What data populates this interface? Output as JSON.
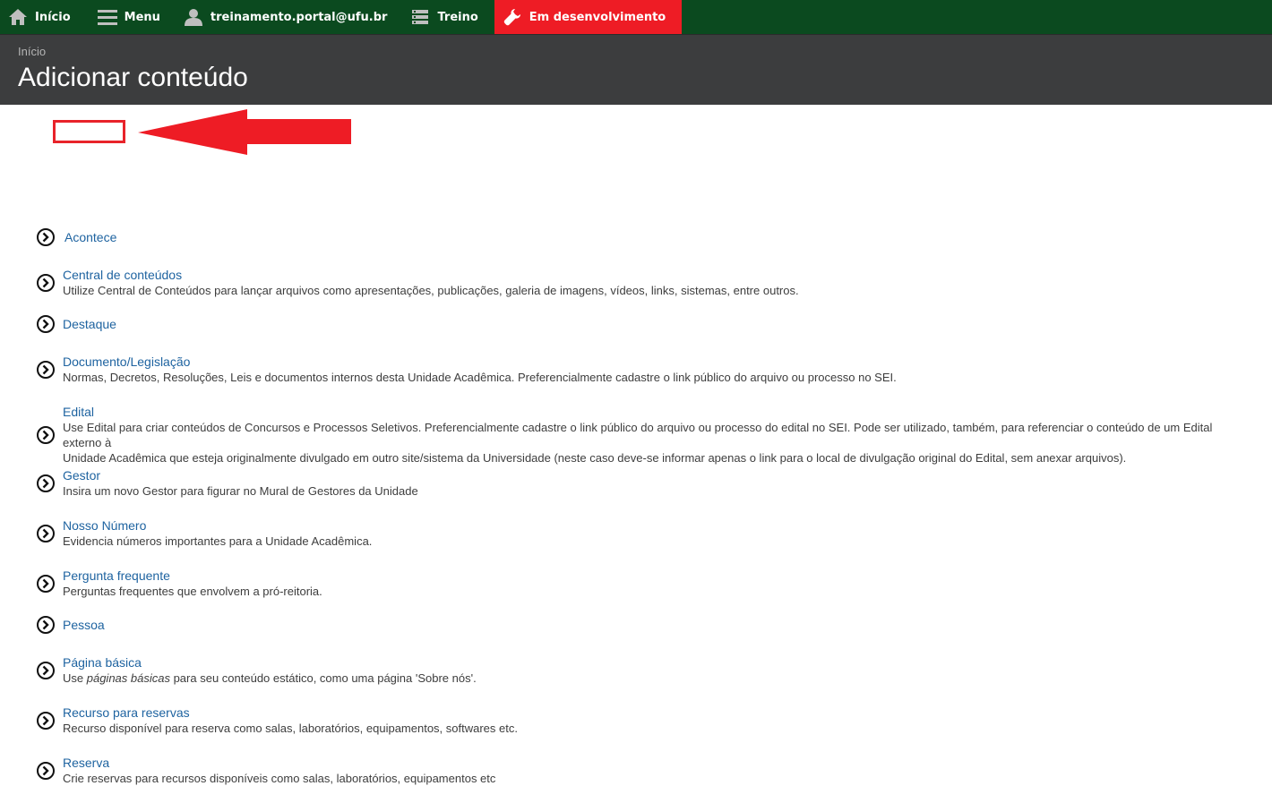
{
  "toolbar": {
    "home_label": "Início",
    "menu_label": "Menu",
    "user_label": "treinamento.portal@ufu.br",
    "shortcuts_label": "Treino",
    "dev_label": "Em desenvolvimento",
    "bg_color": "#0b4a1f",
    "dev_color": "#ee1c25"
  },
  "header": {
    "breadcrumb": "Início",
    "title": "Adicionar conteúdo"
  },
  "content_types": [
    {
      "label": "Acontece",
      "description": ""
    },
    {
      "label": "Central de conteúdos",
      "description": "Utilize Central de Conteúdos para lançar arquivos como apresentações, publicações, galeria de imagens, vídeos, links, sistemas, entre outros."
    },
    {
      "label": "Destaque",
      "description": ""
    },
    {
      "label": "Documento/Legislação",
      "description": "Normas, Decretos, Resoluções, Leis e documentos internos desta Unidade Acadêmica. Preferencialmente cadastre o link público do arquivo ou processo no SEI."
    },
    {
      "label": "Edital",
      "description_line1": "Use Edital para criar conteúdos de Concursos e Processos Seletivos. Preferencialmente cadastre o link público do arquivo ou processo do edital no SEI. Pode ser utilizado, também, para referenciar o conteúdo de um Edital externo à",
      "description_line2": "Unidade Acadêmica que esteja originalmente divulgado em outro site/sistema da Universidade (neste caso deve-se informar apenas o link para o local de divulgação original do Edital, sem anexar arquivos)."
    },
    {
      "label": "Gestor",
      "description": "Insira um novo Gestor para figurar no Mural de Gestores da Unidade"
    },
    {
      "label": "Nosso Número",
      "description": "Evidencia números importantes para a Unidade Acadêmica."
    },
    {
      "label": "Pergunta frequente",
      "description": "Perguntas frequentes que envolvem a pró-reitoria."
    },
    {
      "label": "Pessoa",
      "description": ""
    },
    {
      "label": "Página básica",
      "description_pre": "Use ",
      "description_em": "páginas básicas",
      "description_post": " para seu conteúdo estático, como uma página 'Sobre nós'."
    },
    {
      "label": "Recurso para reservas",
      "description": "Recurso disponível para reserva como salas, laboratórios, equipamentos, softwares etc."
    },
    {
      "label": "Reserva",
      "description": "Crie reservas para recursos disponíveis como salas, laboratórios, equipamentos etc"
    }
  ],
  "icons": {
    "home": "home-icon",
    "menu": "hamburger-icon",
    "user": "user-icon",
    "shortcuts": "shortcuts-icon",
    "dev": "wrench-icon",
    "item": "circle-chevron-right-icon",
    "annotation": "red-arrow-annotation"
  }
}
